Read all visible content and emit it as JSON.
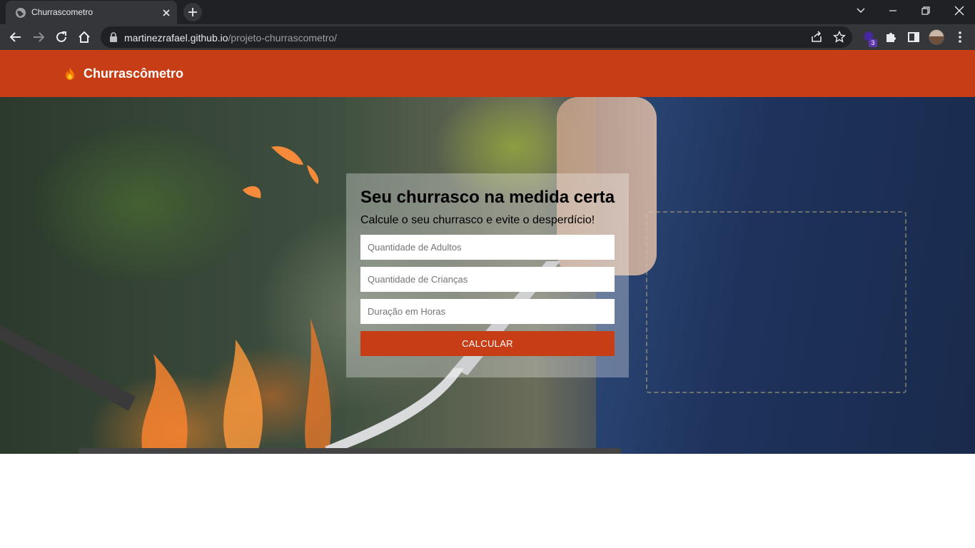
{
  "browser": {
    "tab": {
      "title": "Churrascometro"
    },
    "address": {
      "host": "martinezrafael.github.io",
      "path": "/projeto-churrascometro/"
    },
    "extension_badge": "3"
  },
  "site": {
    "brand": "Churrascômetro",
    "accent": "#c73e16"
  },
  "form": {
    "title": "Seu churrasco na medida certa",
    "subtitle": "Calcule o seu churrasco e evite o desperdício!",
    "adults_placeholder": "Quantidade de Adultos",
    "children_placeholder": "Quantidade de Crianças",
    "hours_placeholder": "Duração em Horas",
    "button_label": "CALCULAR"
  }
}
